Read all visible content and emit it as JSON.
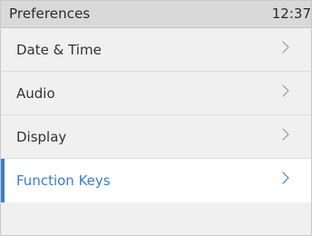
{
  "header": {
    "title": "Preferences",
    "time": "12:37"
  },
  "menu": {
    "items": [
      {
        "label": "Date & Time",
        "icon": "chevron-right-icon"
      },
      {
        "label": "Audio",
        "icon": "chevron-right-icon"
      },
      {
        "label": "Display",
        "icon": "chevron-right-icon"
      },
      {
        "label": "Function Keys",
        "icon": "chevron-right-icon",
        "selected": true
      }
    ]
  },
  "colors": {
    "accent": "#3d7dca",
    "titlebar_bg": "#d9d9d9",
    "list_bg": "#f0f0f0",
    "selected_bg": "#ffffff"
  }
}
